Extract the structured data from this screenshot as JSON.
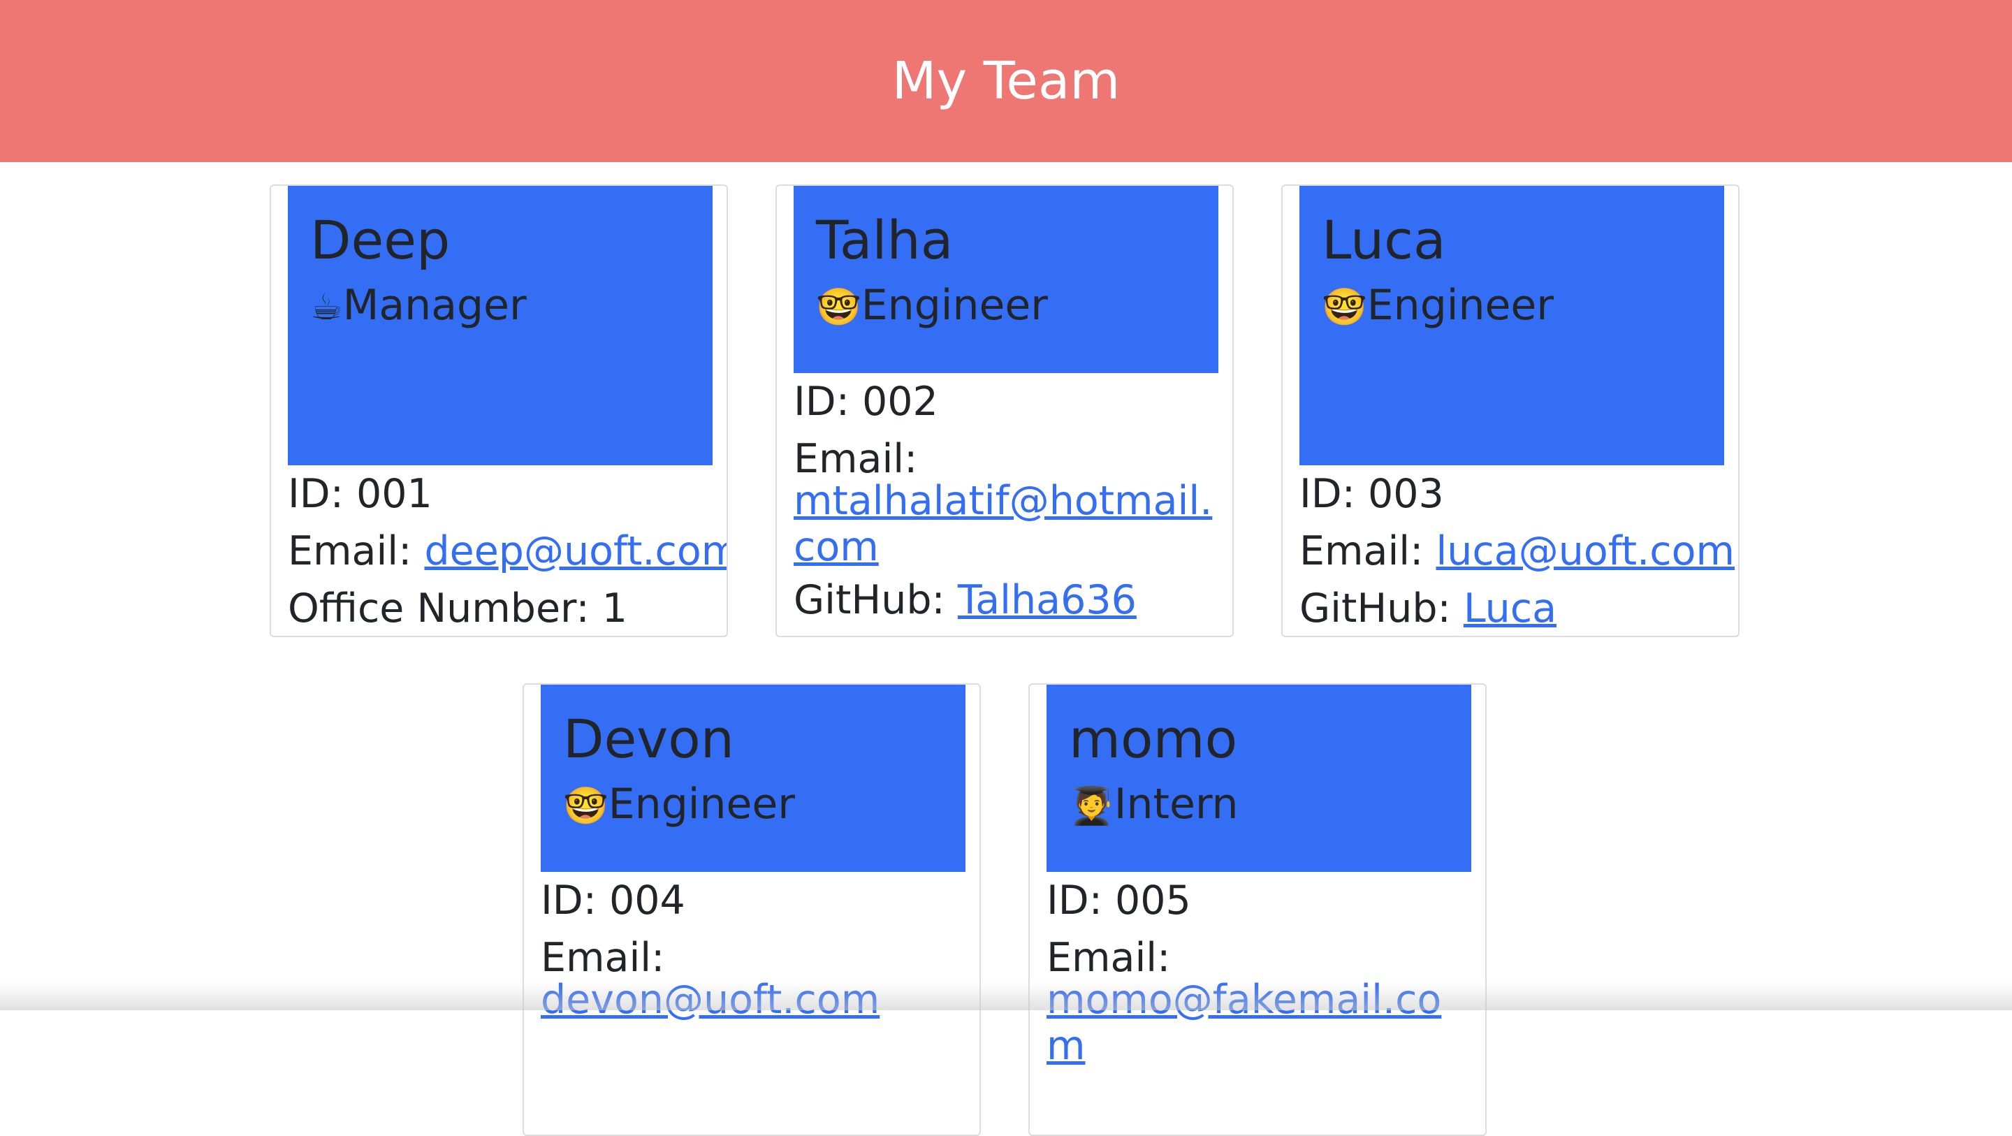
{
  "header": {
    "title": "My Team"
  },
  "colors": {
    "header_bg": "#ee7673",
    "card_head_bg": "#346ef4",
    "link": "#346ef4"
  },
  "cards": [
    {
      "name": "Deep",
      "role_icon": "☕",
      "role": "Manager",
      "id_label": "ID: ",
      "id": "001",
      "email_label": "Email: ",
      "email": "deep@uoft.com",
      "extra_label": "Office Number: ",
      "extra_value": "1"
    },
    {
      "name": "Talha",
      "role_icon": "🤓",
      "role": "Engineer",
      "id_label": "ID: ",
      "id": "002",
      "email_label": "Email:",
      "email": "mtalhalatif@hotmail.com",
      "extra_label": "GitHub: ",
      "extra_value": "Talha636"
    },
    {
      "name": "Luca",
      "role_icon": "🤓",
      "role": "Engineer",
      "id_label": "ID: ",
      "id": "003",
      "email_label": "Email: ",
      "email": "luca@uoft.com",
      "extra_label": "GitHub: ",
      "extra_value": "Luca"
    },
    {
      "name": "Devon",
      "role_icon": "🤓",
      "role": "Engineer",
      "id_label": "ID: ",
      "id": "004",
      "email_label": "Email:",
      "email": "devon@uoft.com"
    },
    {
      "name": "momo",
      "role_icon": "🧑‍🎓",
      "role": "Intern",
      "id_label": "ID: ",
      "id": "005",
      "email_label": "Email:",
      "email": "momo@fakemail.com"
    }
  ]
}
